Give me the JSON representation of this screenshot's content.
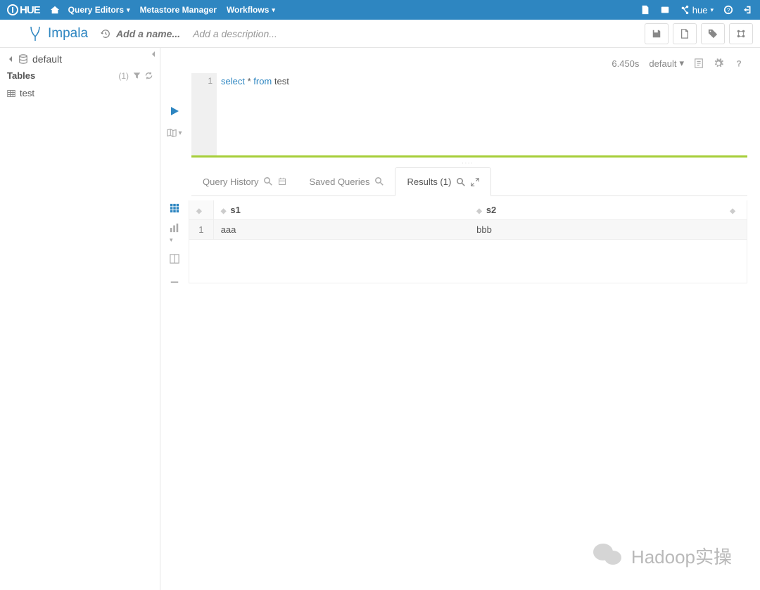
{
  "topnav": {
    "logo": "HUE",
    "menu": [
      "Query Editors",
      "Metastore Manager",
      "Workflows"
    ],
    "user_label": "hue"
  },
  "subheader": {
    "app_title": "Impala",
    "add_name_placeholder": "Add a name...",
    "add_desc_placeholder": "Add a description..."
  },
  "sidebar": {
    "database": "default",
    "tables_label": "Tables",
    "table_count": "(1)",
    "tables": [
      "test"
    ]
  },
  "editor": {
    "elapsed": "6.450s",
    "selected_db": "default",
    "line_number": "1",
    "sql_keyword1": "select",
    "sql_star": " * ",
    "sql_keyword2": "from",
    "sql_rest": " test"
  },
  "tabs": {
    "history": "Query History",
    "saved": "Saved Queries",
    "results": "Results (1)"
  },
  "results": {
    "columns": [
      "s1",
      "s2"
    ],
    "rows": [
      {
        "n": "1",
        "c0": "aaa",
        "c1": "bbb"
      }
    ]
  },
  "watermark": "Hadoop实操"
}
